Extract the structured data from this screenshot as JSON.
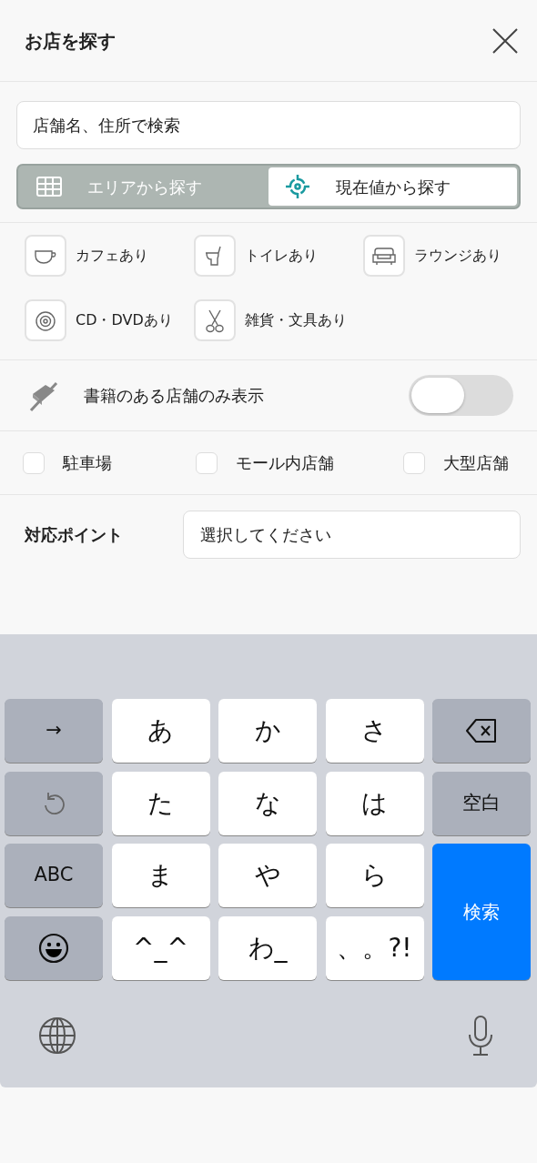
{
  "header": {
    "title": "お店を探す"
  },
  "search": {
    "placeholder": "店舗名、住所で検索"
  },
  "mode_tabs": [
    {
      "label": "エリアから探す",
      "selected": false
    },
    {
      "label": "現在値から探す",
      "selected": true
    }
  ],
  "amenities": [
    {
      "label": "カフェあり"
    },
    {
      "label": "トイレあり"
    },
    {
      "label": "ラウンジあり"
    },
    {
      "label": "CD・DVDあり"
    },
    {
      "label": "雑貨・文具あり"
    }
  ],
  "book_toggle": {
    "label": "書籍のある店舗のみ表示",
    "on": false
  },
  "filters": [
    {
      "label": "駐車場",
      "checked": false
    },
    {
      "label": "モール内店舗",
      "checked": false
    },
    {
      "label": "大型店舗",
      "checked": false
    }
  ],
  "point": {
    "label": "対応ポイント",
    "placeholder": "選択してください"
  },
  "keyboard": {
    "keys": [
      {
        "kind": "function",
        "label": "→"
      },
      {
        "kind": "char",
        "label": "あ"
      },
      {
        "kind": "char",
        "label": "か"
      },
      {
        "kind": "char",
        "label": "さ"
      },
      {
        "kind": "backspace"
      },
      {
        "kind": "undo"
      },
      {
        "kind": "char",
        "label": "た"
      },
      {
        "kind": "char",
        "label": "な"
      },
      {
        "kind": "char",
        "label": "は"
      },
      {
        "kind": "function",
        "label": "空白"
      },
      {
        "kind": "function",
        "label": "ABC"
      },
      {
        "kind": "char",
        "label": "ま"
      },
      {
        "kind": "char",
        "label": "や"
      },
      {
        "kind": "char",
        "label": "ら"
      },
      {
        "kind": "search",
        "label": "検索"
      },
      {
        "kind": "emoji"
      },
      {
        "kind": "char",
        "label": "^_^"
      },
      {
        "kind": "char",
        "label": "わ_"
      },
      {
        "kind": "char",
        "label": "、。?!"
      }
    ]
  }
}
